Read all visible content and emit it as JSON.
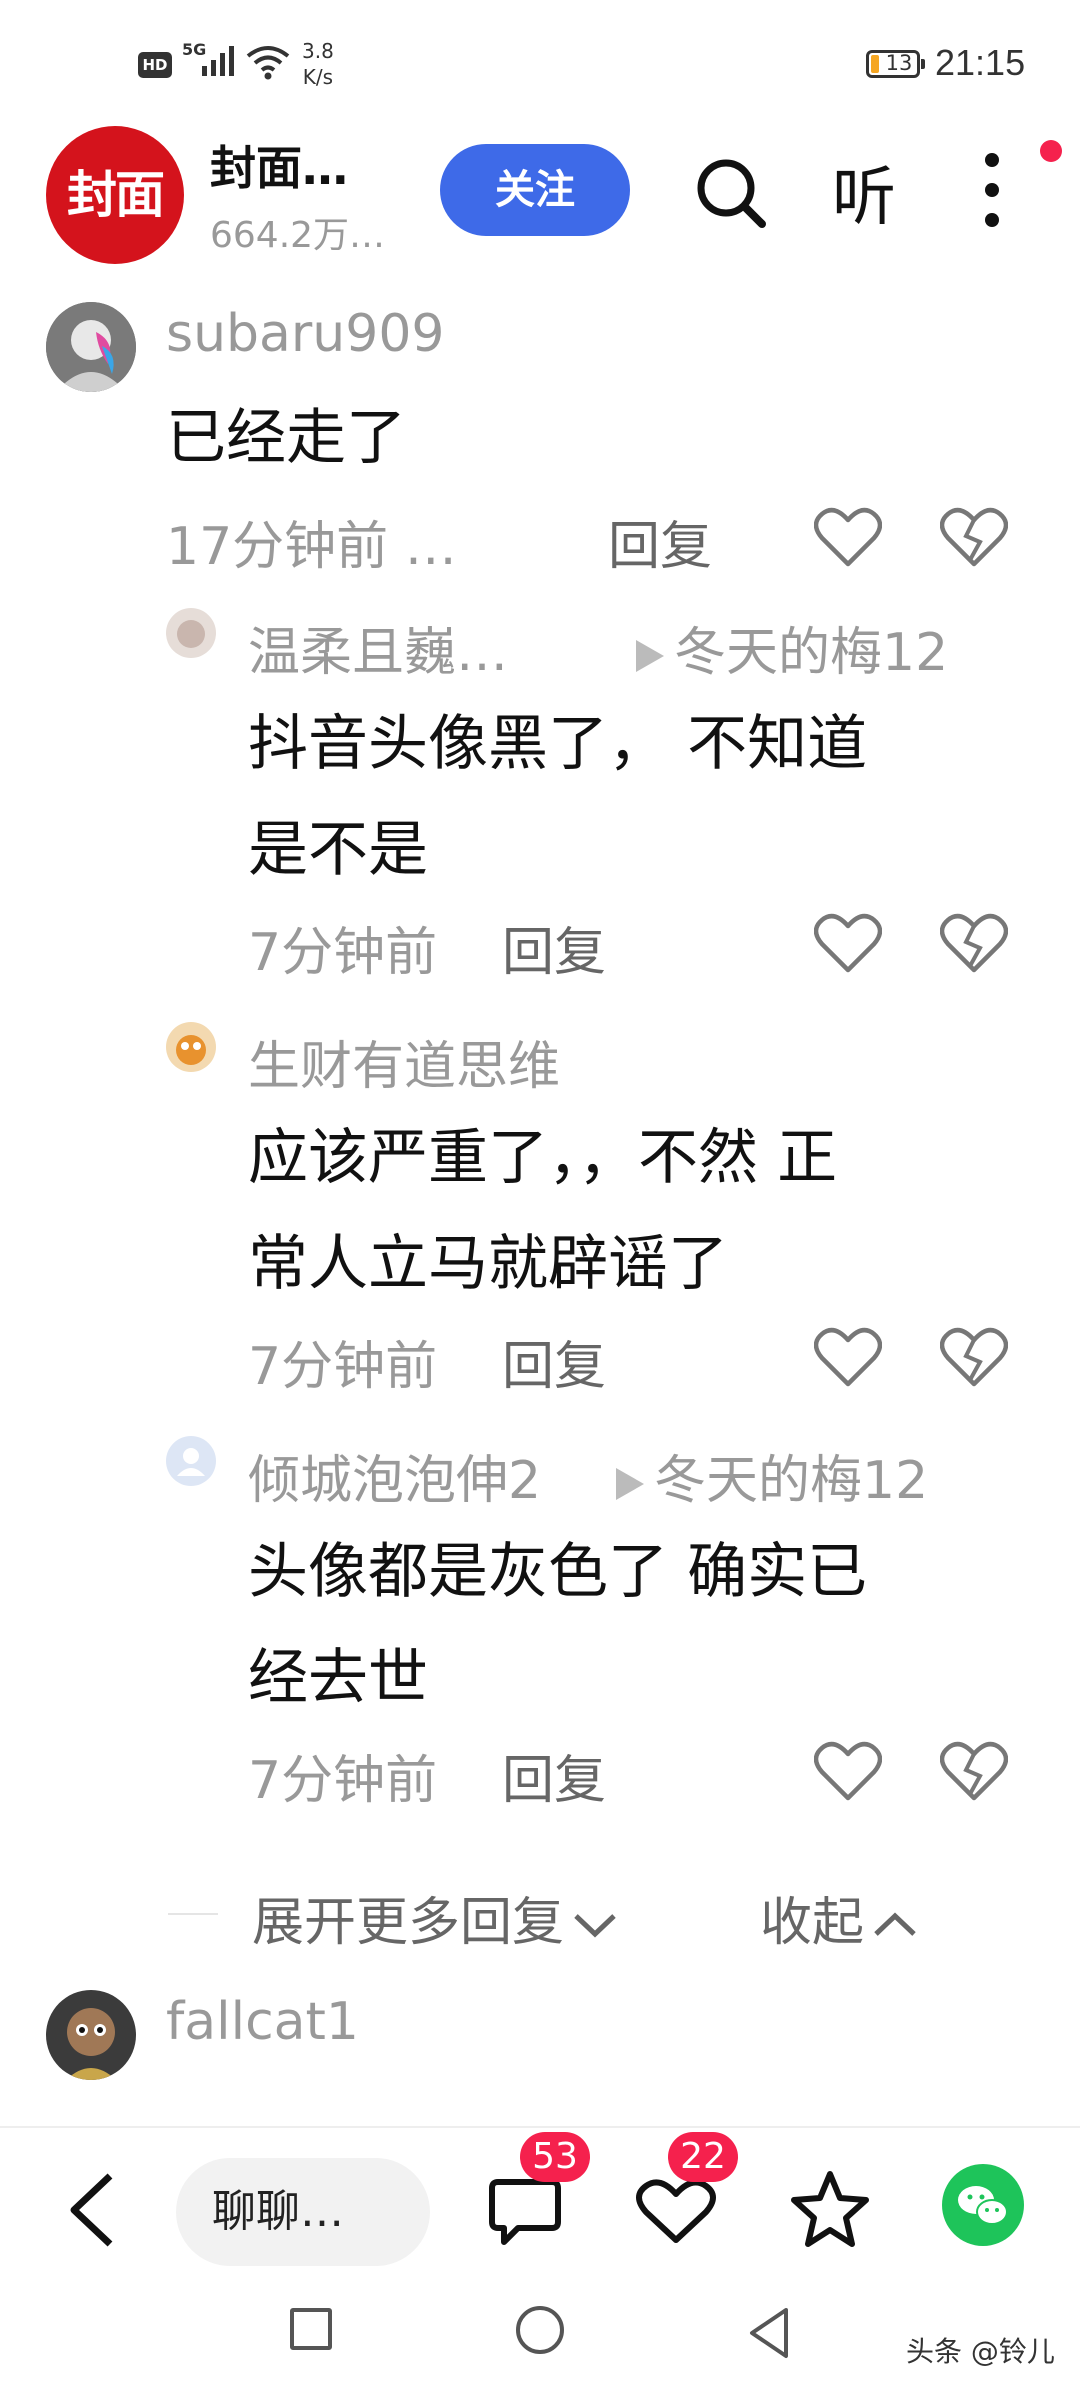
{
  "status_bar": {
    "hd": "HD",
    "network": "5G",
    "speed_value": "3.8",
    "speed_unit": "K/s",
    "battery": "13",
    "time": "21:15"
  },
  "header": {
    "logo_text": "封面",
    "channel_name": "封面…",
    "followers": "664.2万…",
    "follow_label": "关注",
    "listen_label": "听"
  },
  "comments": [
    {
      "user": "subaru909",
      "text": "已经走了",
      "time": "17分钟前  …",
      "reply_label": "回复",
      "replies": [
        {
          "user": "温柔且巍…",
          "reply_to": "冬天的梅12",
          "text_lines": [
            "抖音头像黑了，  不知道",
            "是不是"
          ],
          "time": "7分钟前",
          "reply_label": "回复"
        },
        {
          "user": "生财有道思维",
          "reply_to": "",
          "text_lines": [
            "应该严重了，，不然 正",
            "常人立马就辟谣了"
          ],
          "time": "7分钟前",
          "reply_label": "回复"
        },
        {
          "user": "倾城泡泡伸2",
          "reply_to": "冬天的梅12",
          "text_lines": [
            "头像都是灰色了  确实已",
            "经去世"
          ],
          "time": "7分钟前",
          "reply_label": "回复"
        }
      ],
      "expand_label": "展开更多回复",
      "collapse_label": "收起"
    },
    {
      "user": "fallcat1"
    }
  ],
  "bottom_bar": {
    "input_placeholder": "聊聊…",
    "comment_count": "53",
    "like_count": "22"
  },
  "watermark": "头条 @铃儿",
  "colors": {
    "accent_blue": "#3e6ae8",
    "brand_red": "#d4131c",
    "badge_red": "#f5214d",
    "wechat_green": "#1ec45a"
  }
}
